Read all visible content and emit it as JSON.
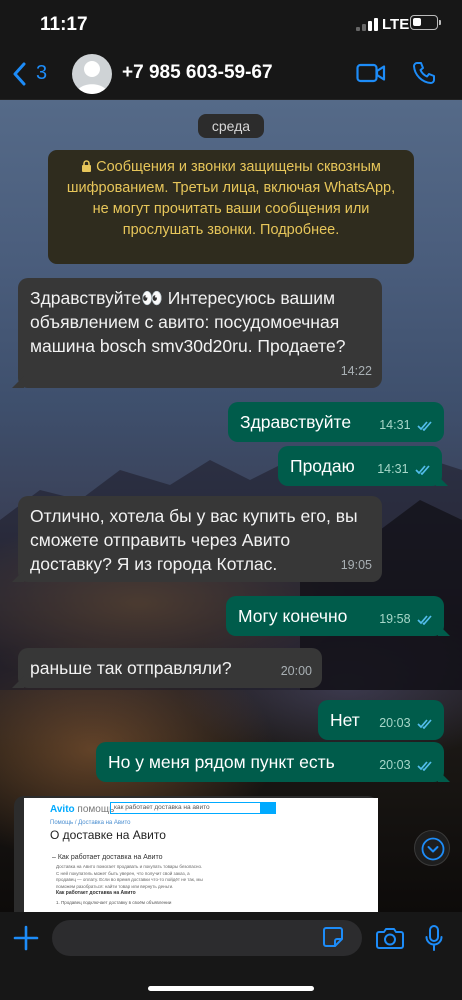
{
  "status_bar": {
    "time": "11:17",
    "network": "LTE"
  },
  "header": {
    "back_count": "3",
    "contact_name": "+7 985 603-59-67"
  },
  "chat": {
    "day_label": "среда",
    "encryption_notice": "Сообщения и звонки защищены сквозным шифрованием. Третьи лица, включая WhatsApp, не могут прочитать ваши сообщения или прослушать звонки. Подробнее.",
    "messages": [
      {
        "direction": "incoming",
        "text": "Здравствуйте👀 Интересуюсь вашим объявлением с авито: посудомоечная машина bosch smv30d20ru. Продаете?",
        "time": "14:22"
      },
      {
        "direction": "outgoing",
        "text": "Здравствуйте",
        "time": "14:31",
        "read": true
      },
      {
        "direction": "outgoing",
        "text": "Продаю",
        "time": "14:31",
        "read": true
      },
      {
        "direction": "incoming",
        "text": "Отлично, хотела бы у вас купить его, вы сможете отправить через Авито доставку? Я из города Котлас.",
        "time": "19:05"
      },
      {
        "direction": "outgoing",
        "text": "Могу конечно",
        "time": "19:58",
        "read": true
      },
      {
        "direction": "incoming",
        "text": "раньше так отправляли?",
        "time": "20:00"
      },
      {
        "direction": "outgoing",
        "text": "Нет",
        "time": "20:03",
        "read": true
      },
      {
        "direction": "outgoing",
        "text": "Но у меня рядом пункт есть",
        "time": "20:03",
        "read": true
      }
    ],
    "link_preview": {
      "site_brand": "Avito",
      "site_section": "помощь",
      "search_text": "как работает доставка на авито",
      "breadcrumb": "Помощь / Доставка на Авито",
      "page_title": "О доставке на Авито",
      "section_heading": "– Как работает доставка на Авито",
      "body_text": "Доставка на Авито помогает продавать и покупать товары безопасно. С ней покупатель может быть уверен, что получит свой заказ, а продавец — оплату. Если во время доставки что-то пойдёт не так, мы поможем разобраться: найти товар или вернуть деньги.",
      "subheading": "Как работает доставка на Авито",
      "list_item": "1. Продавец подключает доставку в своём объявлении"
    }
  },
  "colors": {
    "accent": "#1d8cf8",
    "outgoing_bubble": "#005c4b",
    "incoming_bubble": "#373737",
    "read_ticks": "#53bdeb",
    "notice_text": "#e7c65a"
  },
  "icons": [
    "chevron-left-icon",
    "avatar-icon",
    "video-call-icon",
    "phone-icon",
    "lock-icon",
    "read-ticks-icon",
    "chevron-down-icon",
    "plus-icon",
    "sticker-icon",
    "camera-icon",
    "mic-icon"
  ]
}
